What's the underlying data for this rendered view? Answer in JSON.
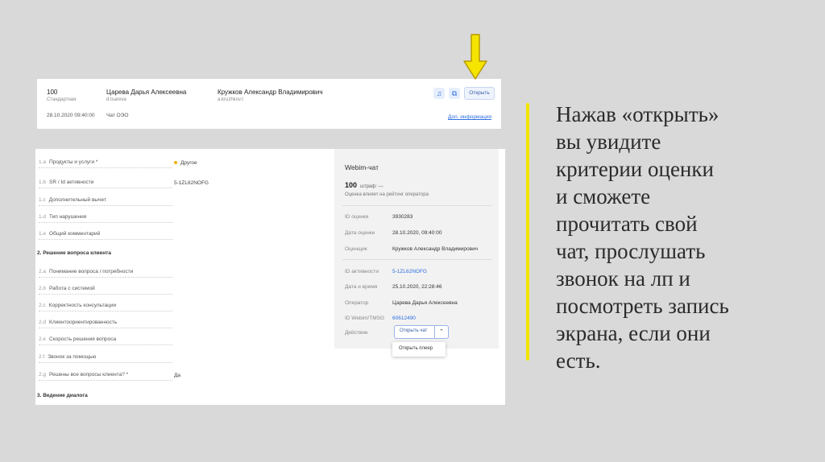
{
  "top_card": {
    "score": "100",
    "score_type": "Стандартная",
    "operator_name": "Царева Дарья Алексеевна",
    "operator_login": "d.tsareva",
    "evaluator_name": "Кружков Александр Владимирович",
    "evaluator_login": "a.kruzhkov.t",
    "date": "28.10.2020 09:40:00",
    "channel": "Чат ОЭО",
    "open_button": "Открыть",
    "more_link": "Доп. информация"
  },
  "criteria": [
    {
      "num": "1.a",
      "label": "Продукты и услуги *",
      "value": "Другое"
    },
    {
      "num": "1.b",
      "label": "SR / Id активности",
      "value": "5-1ZL62NOFG"
    },
    {
      "num": "1.c",
      "label": "Дополнительный вычет",
      "value": ""
    },
    {
      "num": "1.d",
      "label": "Тип нарушения",
      "value": ""
    },
    {
      "num": "1.e",
      "label": "Общий комментарий",
      "value": ""
    },
    {
      "num": "2.a",
      "label": "Понимание вопроса / потребности",
      "value": ""
    },
    {
      "num": "2.b",
      "label": "Работа с системой",
      "value": ""
    },
    {
      "num": "2.c",
      "label": "Корректность консультации",
      "value": ""
    },
    {
      "num": "2.d",
      "label": "Клиентоориентированность",
      "value": ""
    },
    {
      "num": "2.e",
      "label": "Скорость решения вопроса",
      "value": ""
    },
    {
      "num": "2.f",
      "label": "Звонок за помощью",
      "value": ""
    },
    {
      "num": "2.g",
      "label": "Решены все вопросы клиента? *",
      "value": "Да"
    }
  ],
  "sections": {
    "s2": "2.  Решение вопроса клиента",
    "s3": "3.  Ведение диалога"
  },
  "panel": {
    "title": "Webim-чат",
    "score": "100",
    "score_sub": "штраф: —",
    "note": "Оценка влияет на рейтинг оператора",
    "rows": [
      {
        "label": "ID оценки",
        "value": "3930283"
      },
      {
        "label": "Дата оценки",
        "value": "28.10.2020, 09:40:00"
      },
      {
        "label": "Оценщик",
        "value": "Кружков Александр Владимирович"
      },
      {
        "label": "ID активности",
        "value": "5-1ZL62NOFG"
      },
      {
        "label": "Дата и время",
        "value": "25.10.2020, 22:28:46"
      },
      {
        "label": "Оператор",
        "value": "Царева Дарья Алексеевна"
      },
      {
        "label": "ID Webim/TMSG",
        "value": "60612490"
      },
      {
        "label": "Действие",
        "value": ""
      }
    ],
    "action_select": "Открыть чат",
    "dropdown_item": "Открыть плеер"
  },
  "side_text": [
    "Нажав «открыть»",
    "вы увидите",
    "критерии оценки",
    "и сможете",
    "прочитать свой",
    "чат, прослушать",
    "звонок на лп и",
    "посмотреть запись",
    "экрана, если они",
    "есть."
  ],
  "colors": {
    "arrow": "#f5e400",
    "accent": "#2f6fe0",
    "slide_bg": "#d9d9d9"
  }
}
